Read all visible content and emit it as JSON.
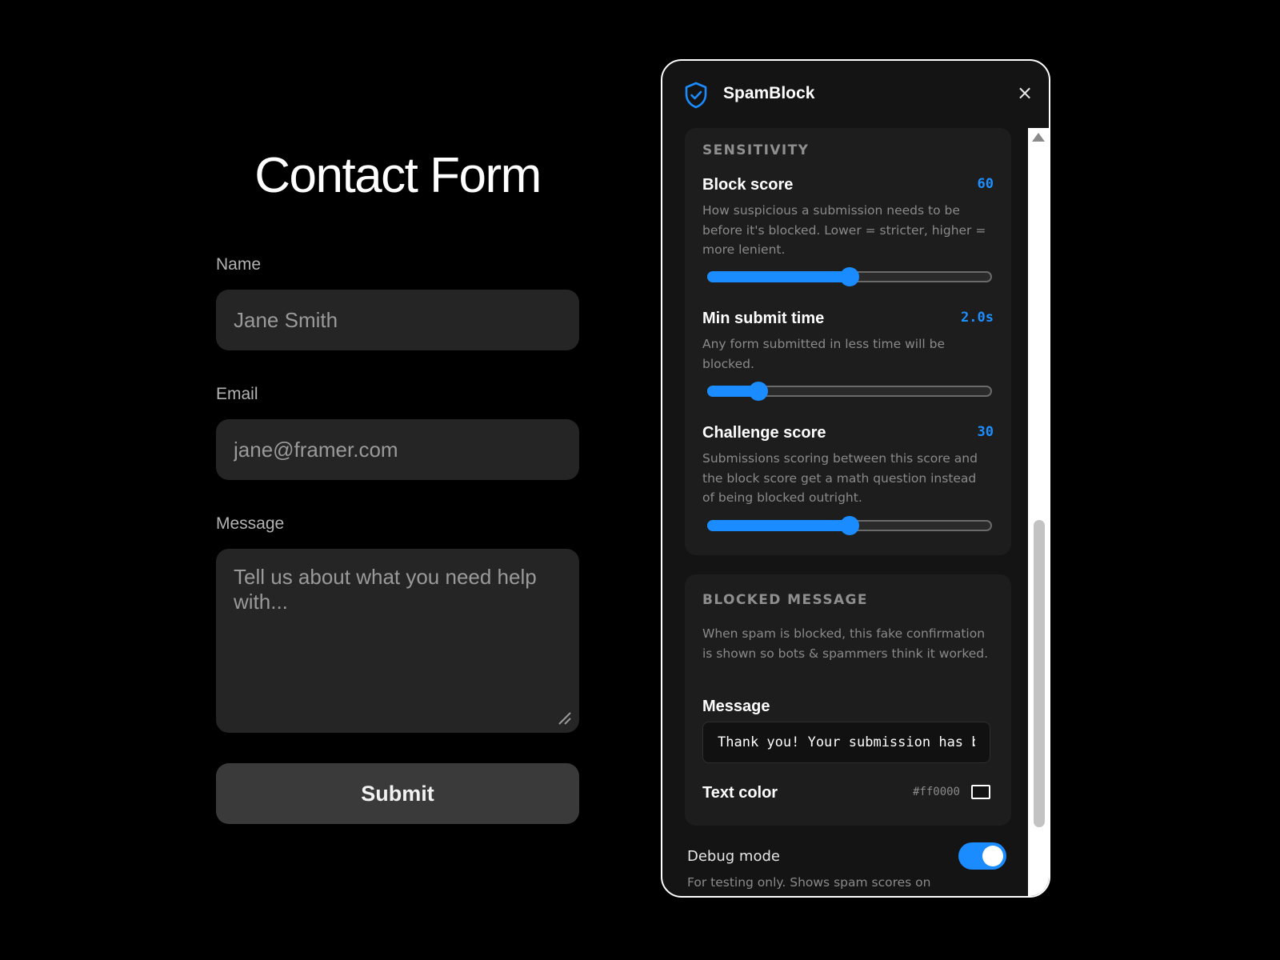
{
  "form": {
    "title": "Contact Form",
    "name_label": "Name",
    "name_placeholder": "Jane Smith",
    "email_label": "Email",
    "email_placeholder": "jane@framer.com",
    "message_label": "Message",
    "message_placeholder": "Tell us about what you need help with...",
    "submit_label": "Submit"
  },
  "panel": {
    "title": "SpamBlock",
    "close_symbol": "×",
    "icons": {
      "logo": "shield-check-icon",
      "close": "close-icon"
    },
    "accent_color": "#1a8cff",
    "sensitivity": {
      "title": "SENSITIVITY",
      "block_score": {
        "label": "Block score",
        "value": "60",
        "description": "How suspicious a submission needs to be before it's blocked. Lower = stricter, higher = more lenient.",
        "fraction": 0.5
      },
      "min_submit_time": {
        "label": "Min submit time",
        "value": "2.0s",
        "description": "Any form submitted in less time will be blocked.",
        "fraction": 0.18
      },
      "challenge_score": {
        "label": "Challenge score",
        "value": "30",
        "description": "Submissions scoring between this score and the block score get a math question instead of being blocked outright.",
        "fraction": 0.5
      }
    },
    "blocked_message": {
      "title": "BLOCKED MESSAGE",
      "description": "When spam is blocked, this fake confirmation is shown so bots & spammers think it worked.",
      "message_label": "Message",
      "message_value": "Thank you! Your submission has been received!",
      "text_color_label": "Text color",
      "text_color_value": "#ff0000"
    },
    "debug": {
      "label": "Debug mode",
      "enabled": true,
      "description": "For testing only. Shows spam scores on"
    }
  }
}
